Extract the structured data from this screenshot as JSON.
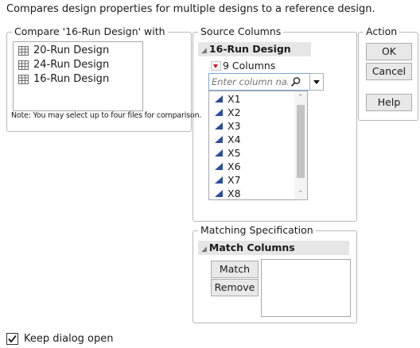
{
  "description": "Compares design properties for multiple designs to a reference design.",
  "compare": {
    "legend": "Compare '16-Run Design' with",
    "files": [
      "20-Run Design",
      "24-Run Design",
      "16-Run Design"
    ],
    "note": "Note: You may select up to four files for comparison."
  },
  "source": {
    "legend": "Source Columns",
    "table_name": "16-Run Design",
    "column_count": "9 Columns",
    "filter_placeholder": "Enter column nai",
    "columns": [
      "X1",
      "X2",
      "X3",
      "X4",
      "X5",
      "X6",
      "X7",
      "X8"
    ]
  },
  "action": {
    "legend": "Action",
    "ok": "OK",
    "cancel": "Cancel",
    "help": "Help"
  },
  "matching": {
    "legend": "Matching Specification",
    "header": "Match Columns",
    "match_label": "Match",
    "remove_label": "Remove"
  },
  "footer": {
    "keep_open_label": "Keep dialog open",
    "keep_open_checked": true
  },
  "colors": {
    "continuous_icon": "#2b4fa0",
    "red_triangle": "#cc1f1f"
  }
}
